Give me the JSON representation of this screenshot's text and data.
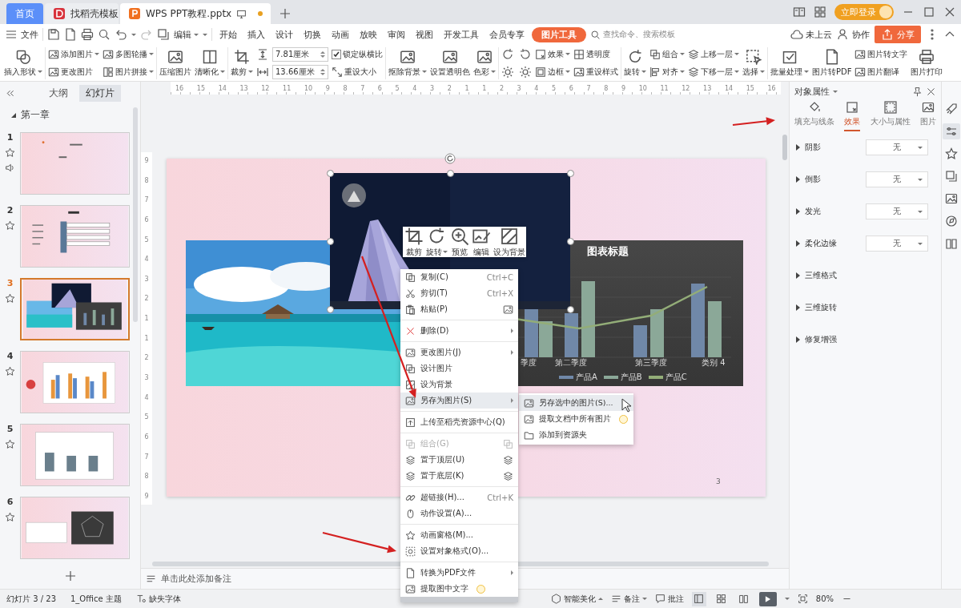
{
  "title_bar": {
    "tabs": [
      {
        "label": "首页",
        "kind": "home",
        "selected": false
      },
      {
        "label": "找稻壳模板",
        "kind": "docer",
        "selected": false
      },
      {
        "label": "WPS PPT教程.pptx",
        "kind": "presentation",
        "selected": true,
        "unsaved": true
      }
    ],
    "login": "立即登录"
  },
  "menu_bar": {
    "file": "文件",
    "edit": "编辑",
    "tabs": [
      {
        "label": "开始",
        "selected": false
      },
      {
        "label": "插入",
        "selected": false
      },
      {
        "label": "设计",
        "selected": false
      },
      {
        "label": "切换",
        "selected": false
      },
      {
        "label": "动画",
        "selected": false
      },
      {
        "label": "放映",
        "selected": false
      },
      {
        "label": "审阅",
        "selected": false
      },
      {
        "label": "视图",
        "selected": false
      },
      {
        "label": "开发工具",
        "selected": false
      },
      {
        "label": "会员专享",
        "selected": false
      },
      {
        "label": "图片工具",
        "selected": true
      }
    ],
    "search": {
      "placeholder": "查找命令、搜索模板"
    },
    "cloud": "未上云",
    "collaborate": "协作",
    "share": "分享"
  },
  "ribbon": {
    "groups": [
      [
        {
          "kind": "big",
          "label": "插入形状",
          "dropdown": true
        }
      ],
      [
        {
          "kind": "pair",
          "items": [
            {
              "label": "添加图片",
              "dropdown": true
            },
            {
              "label": "更改图片",
              "dropdown": false
            }
          ]
        },
        {
          "kind": "pair",
          "items": [
            {
              "label": "多图轮播",
              "dropdown": true
            },
            {
              "label": "图片拼接",
              "dropdown": true
            }
          ]
        }
      ],
      [
        {
          "kind": "big",
          "label": "压缩图片",
          "dropdown": false
        },
        {
          "kind": "big",
          "label": "清晰化",
          "dropdown": true
        }
      ],
      [
        {
          "kind": "big",
          "label": "裁剪",
          "dropdown": true
        },
        {
          "kind": "sizes",
          "items": [
            {
              "value": "7.81厘米"
            },
            {
              "value": "13.66厘米"
            }
          ]
        },
        {
          "kind": "pair",
          "items": [
            {
              "label": "锁定纵横比",
              "checked": true
            },
            {
              "label": "重设大小",
              "dropdown": false
            }
          ]
        }
      ],
      [
        {
          "kind": "big",
          "label": "抠除背景",
          "dropdown": true
        },
        {
          "kind": "big",
          "label": "设置透明色",
          "dropdown": false
        },
        {
          "kind": "big",
          "label": "色彩",
          "dropdown": true
        }
      ],
      [
        {
          "kind": "adjust"
        },
        {
          "kind": "pair",
          "items": [
            {
              "label": "效果",
              "dropdown": true
            },
            {
              "label": "边框",
              "dropdown": true
            }
          ]
        },
        {
          "kind": "pair",
          "items": [
            {
              "label": "透明度",
              "dropdown": false
            },
            {
              "label": "重设样式",
              "dropdown": false
            }
          ]
        }
      ],
      [
        {
          "kind": "big",
          "label": "旋转",
          "dropdown": true
        },
        {
          "kind": "pair",
          "items": [
            {
              "label": "组合",
              "dropdown": true
            },
            {
              "label": "对齐",
              "dropdown": true
            }
          ]
        },
        {
          "kind": "pair",
          "items": [
            {
              "label": "上移一层",
              "dropdown": true
            },
            {
              "label": "下移一层",
              "dropdown": true
            }
          ]
        },
        {
          "kind": "big",
          "label": "选择",
          "dropdown": true
        }
      ],
      [
        {
          "kind": "big",
          "label": "批量处理",
          "dropdown": true
        },
        {
          "kind": "big",
          "label": "图片转PDF",
          "dropdown": false
        },
        {
          "kind": "pair",
          "items": [
            {
              "label": "图片转文字",
              "dropdown": false
            },
            {
              "label": "图片翻译",
              "dropdown": false
            }
          ]
        },
        {
          "kind": "big",
          "label": "图片打印",
          "dropdown": false
        }
      ]
    ]
  },
  "slides_panel": {
    "tabs": [
      {
        "label": "大纲",
        "selected": false
      },
      {
        "label": "幻灯片",
        "selected": true
      }
    ],
    "section": {
      "label": "第一章",
      "expanded": true
    },
    "slides": [
      {
        "number": "1",
        "kind": "title",
        "selected": false,
        "animated": true,
        "audio": true
      },
      {
        "number": "2",
        "kind": "toc",
        "selected": false,
        "animated": true,
        "audio": false
      },
      {
        "number": "3",
        "kind": "pictures",
        "selected": true,
        "animated": true,
        "audio": false
      },
      {
        "number": "4",
        "kind": "bar_chart",
        "selected": false,
        "animated": true,
        "audio": false
      },
      {
        "number": "5",
        "kind": "column_chart",
        "selected": false,
        "animated": true,
        "audio": false
      },
      {
        "number": "6",
        "kind": "radar",
        "selected": false,
        "animated": true,
        "audio": false
      }
    ]
  },
  "editor": {
    "ruler_h": [
      "16",
      "15",
      "14",
      "13",
      "12",
      "11",
      "10",
      "9",
      "8",
      "7",
      "6",
      "5",
      "4",
      "3",
      "2",
      "1",
      "1",
      "2",
      "3",
      "4",
      "5",
      "6",
      "7",
      "8",
      "9",
      "10",
      "11",
      "12",
      "13",
      "14",
      "15",
      "16"
    ],
    "ruler_v": [
      "9",
      "8",
      "7",
      "6",
      "5",
      "4",
      "3",
      "2",
      "1",
      "1",
      "2",
      "3",
      "4",
      "5",
      "6",
      "7",
      "8",
      "9"
    ],
    "slide": {
      "number": "3",
      "chart": {
        "title": "图表标题",
        "categories": [
          "季度",
          "第二季度",
          "第三季度",
          "类别 4"
        ],
        "legend": [
          {
            "label": "产品A",
            "color": "#7088a8"
          },
          {
            "label": "产品B",
            "color": "#8ba898"
          },
          {
            "label": "产品C",
            "color": "#93ad78"
          }
        ]
      }
    },
    "notes_hint": "单击此处添加备注"
  },
  "image_toolbar": [
    {
      "label": "裁剪",
      "dropdown": false
    },
    {
      "label": "旋转",
      "dropdown": true
    },
    {
      "label": "预览",
      "dropdown": false
    },
    {
      "label": "编辑",
      "dropdown": false
    },
    {
      "label": "设为背景",
      "dropdown": false
    }
  ],
  "context_menu": [
    {
      "kind": "item",
      "label": "复制(C)",
      "shortcut": "Ctrl+C",
      "selected": false,
      "disabled": false
    },
    {
      "kind": "item",
      "label": "剪切(T)",
      "shortcut": "Ctrl+X",
      "selected": false,
      "disabled": false
    },
    {
      "kind": "item",
      "label": "粘贴(P)",
      "side_icon": true,
      "selected": false,
      "disabled": false
    },
    {
      "kind": "separator"
    },
    {
      "kind": "item",
      "label": "删除(D)",
      "submenu": true,
      "selected": false,
      "disabled": false
    },
    {
      "kind": "separator"
    },
    {
      "kind": "item",
      "label": "更改图片(J)",
      "submenu": true,
      "selected": false,
      "disabled": false
    },
    {
      "kind": "item",
      "label": "设计图片",
      "selected": false,
      "disabled": false
    },
    {
      "kind": "item",
      "label": "设为背景",
      "selected": false,
      "disabled": false
    },
    {
      "kind": "item",
      "label": "另存为图片(S)",
      "submenu": true,
      "selected": true,
      "disabled": false,
      "children": [
        {
          "label": "另存选中的图片(S)...",
          "selected": true
        },
        {
          "label": "提取文档中所有图片",
          "selected": false,
          "premium": true
        },
        {
          "label": "添加到资源夹",
          "selected": false
        }
      ]
    },
    {
      "kind": "separator"
    },
    {
      "kind": "item",
      "label": "上传至稻壳资源中心(Q)",
      "selected": false,
      "disabled": false
    },
    {
      "kind": "separator"
    },
    {
      "kind": "item",
      "label": "组合(G)",
      "side_icon": true,
      "selected": false,
      "disabled": true
    },
    {
      "kind": "item",
      "label": "置于顶层(U)",
      "side_icon": true,
      "selected": false,
      "disabled": false
    },
    {
      "kind": "item",
      "label": "置于底层(K)",
      "side_icon": true,
      "selected": false,
      "disabled": false
    },
    {
      "kind": "separator"
    },
    {
      "kind": "item",
      "label": "超链接(H)...",
      "shortcut": "Ctrl+K",
      "selected": false,
      "disabled": false
    },
    {
      "kind": "item",
      "label": "动作设置(A)...",
      "selected": false,
      "disabled": false
    },
    {
      "kind": "separator"
    },
    {
      "kind": "item",
      "label": "动画窗格(M)...",
      "selected": false,
      "disabled": false
    },
    {
      "kind": "item",
      "label": "设置对象格式(O)...",
      "selected": false,
      "disabled": false
    },
    {
      "kind": "separator"
    },
    {
      "kind": "item",
      "label": "转换为PDF文件",
      "submenu": true,
      "selected": false,
      "disabled": false
    },
    {
      "kind": "item",
      "label": "提取图中文字",
      "premium": true,
      "selected": false,
      "disabled": false
    }
  ],
  "properties_panel": {
    "title": "对象属性",
    "tabs": [
      {
        "label": "填充与线条",
        "selected": false
      },
      {
        "label": "效果",
        "selected": true
      },
      {
        "label": "大小与属性",
        "selected": false
      },
      {
        "label": "图片",
        "selected": false
      }
    ],
    "sections": [
      {
        "label": "阴影",
        "expanded": false,
        "value": "无"
      },
      {
        "label": "倒影",
        "expanded": false,
        "value": "无"
      },
      {
        "label": "发光",
        "expanded": false,
        "value": "无"
      },
      {
        "label": "柔化边缘",
        "expanded": false,
        "value": "无"
      },
      {
        "label": "三维格式",
        "expanded": false
      },
      {
        "label": "三维旋转",
        "expanded": false
      },
      {
        "label": "修复增强",
        "expanded": false
      }
    ]
  },
  "side_rail": [
    {
      "selected": false
    },
    {
      "selected": true
    },
    {
      "selected": false
    },
    {
      "selected": false
    },
    {
      "selected": false
    },
    {
      "selected": false
    },
    {
      "selected": false
    }
  ],
  "status_bar": {
    "slide_counter": "幻灯片 3 / 23",
    "theme": "1_Office 主题",
    "missing_font": "缺失字体",
    "beautify": "智能美化",
    "notes": "备注",
    "comments": "批注",
    "views": [
      {
        "selected": true
      },
      {
        "selected": false
      },
      {
        "selected": false
      }
    ],
    "zoom": "80%"
  }
}
